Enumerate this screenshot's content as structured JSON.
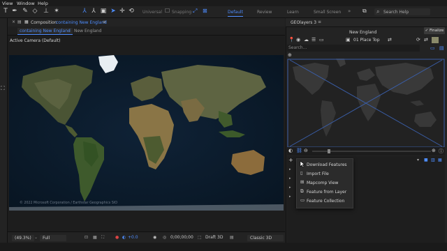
{
  "menubar": {
    "items": [
      "View",
      "Window",
      "Help"
    ]
  },
  "toolbar": {
    "tools": [
      "type-tool",
      "pen-tool",
      "eraser-tool",
      "pin-tool",
      "puppet-tool",
      "axis-tool",
      "world-axis-tool",
      "view-axis-tool",
      "selection-tool",
      "hand-tool",
      "rotate-tool"
    ],
    "mode_labels": [
      "Universal",
      "Snapping"
    ],
    "workspaces": [
      "Default",
      "Review",
      "Learn",
      "Small Screen"
    ],
    "active_workspace": "Default",
    "search_placeholder": "Search Help"
  },
  "composition": {
    "panel_label": "Composition",
    "comp_name": "containing New England",
    "tabs": [
      "containing New England",
      "New England"
    ],
    "camera_label": "Active Camera (Default)",
    "attribution": "© 2022 Microsoft Corporation / Earthstar Geographics SIO"
  },
  "bottom_bar": {
    "zoom": "(49.3%)",
    "resolution": "Full",
    "exposure": "+0.0",
    "timecode": "0;00;00;00",
    "renderer_label": "Draft 3D",
    "renderer_mode": "Classic 3D"
  },
  "geolayers": {
    "title": "GEOlayers 3",
    "comp_name": "New England",
    "finalize_label": "Finalize",
    "place_selector": "01 Place Top",
    "search_placeholder": "Search..."
  },
  "context_menu": {
    "items": [
      {
        "label": "Download Features",
        "icon": "download-icon"
      },
      {
        "label": "Import File",
        "icon": "file-icon"
      },
      {
        "label": "Mapcomp View",
        "icon": "map-icon"
      },
      {
        "label": "Feature from Layer",
        "icon": "layer-icon"
      },
      {
        "label": "Feature Collection",
        "icon": "folder-icon"
      }
    ]
  },
  "colors": {
    "accent": "#4e8dff",
    "panel_bg": "#232323",
    "map_ocean": "#0b1a2b"
  }
}
